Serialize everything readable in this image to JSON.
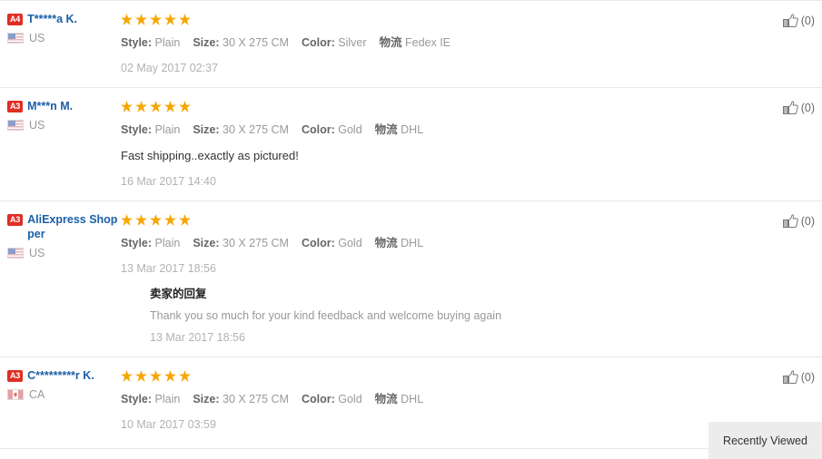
{
  "reviews": [
    {
      "level_badge": "A4",
      "user_name": "T*****a K.",
      "country_code": "US",
      "flag": "us-flag-icon",
      "rating": 5,
      "attrs": [
        {
          "label": "Style:",
          "value": "Plain"
        },
        {
          "label": "Size:",
          "value": "30 X 275 CM"
        },
        {
          "label": "Color:",
          "value": "Silver"
        },
        {
          "label": "物流",
          "value": "Fedex IE"
        }
      ],
      "comment": "",
      "date": "02 May 2017 02:37",
      "helpful_count": "(0)",
      "reply": null
    },
    {
      "level_badge": "A3",
      "user_name": "M***n M.",
      "country_code": "US",
      "flag": "us-flag-icon",
      "rating": 5,
      "attrs": [
        {
          "label": "Style:",
          "value": "Plain"
        },
        {
          "label": "Size:",
          "value": "30 X 275 CM"
        },
        {
          "label": "Color:",
          "value": "Gold"
        },
        {
          "label": "物流",
          "value": "DHL"
        }
      ],
      "comment": "Fast shipping..exactly as pictured!",
      "date": "16 Mar 2017 14:40",
      "helpful_count": "(0)",
      "reply": null
    },
    {
      "level_badge": "A3",
      "user_name": "AliExpress Shopper",
      "country_code": "US",
      "flag": "us-flag-icon",
      "rating": 5,
      "attrs": [
        {
          "label": "Style:",
          "value": "Plain"
        },
        {
          "label": "Size:",
          "value": "30 X 275 CM"
        },
        {
          "label": "Color:",
          "value": "Gold"
        },
        {
          "label": "物流",
          "value": "DHL"
        }
      ],
      "comment": "",
      "date": "13 Mar 2017 18:56",
      "helpful_count": "(0)",
      "reply": {
        "title": "卖家的回复",
        "body": "Thank you so much for your kind feedback and welcome buying again",
        "date": "13 Mar 2017 18:56"
      }
    },
    {
      "level_badge": "A3",
      "user_name": "C*********r K.",
      "country_code": "CA",
      "flag": "ca-flag-icon",
      "rating": 5,
      "attrs": [
        {
          "label": "Style:",
          "value": "Plain"
        },
        {
          "label": "Size:",
          "value": "30 X 275 CM"
        },
        {
          "label": "Color:",
          "value": "Gold"
        },
        {
          "label": "物流",
          "value": "DHL"
        }
      ],
      "comment": "",
      "date": "10 Mar 2017 03:59",
      "helpful_count": "(0)",
      "reply": null
    }
  ],
  "recently_viewed": {
    "label": "Recently Viewed"
  },
  "colors": {
    "badge_red": "#e02e24",
    "star_orange": "#f7a500",
    "username_blue": "#1c5fa8",
    "separator": "#e8e8e8",
    "tab_bg": "#ececec"
  }
}
